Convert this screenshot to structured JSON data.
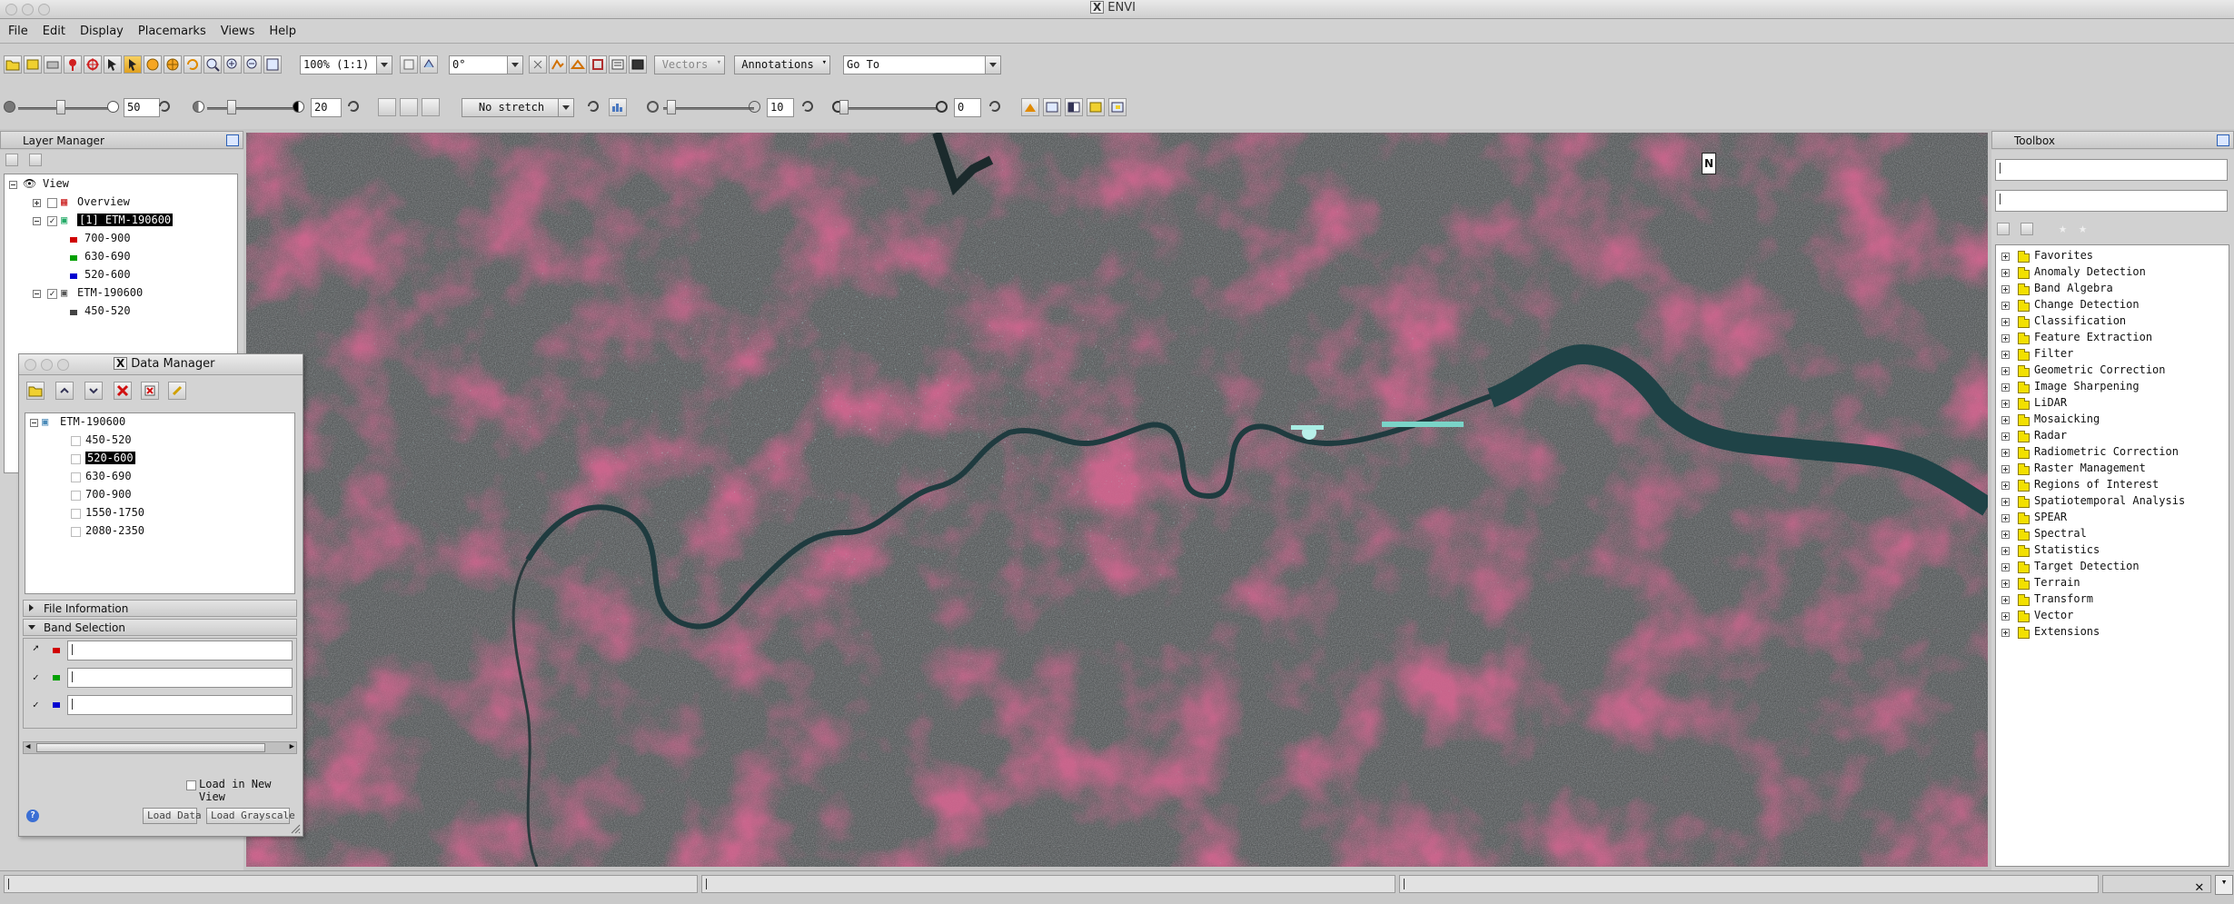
{
  "window": {
    "title": "ENVI"
  },
  "menu": [
    "File",
    "Edit",
    "Display",
    "Placemarks",
    "Views",
    "Help"
  ],
  "toolbar1": {
    "zoom_value": "100% (1:1)",
    "rotation_value": "0°",
    "vectors_label": "Vectors",
    "annotations_label": "Annotations",
    "goto_placeholder": "Go To"
  },
  "toolbar2": {
    "brightness": "50",
    "contrast": "20",
    "stretch": "No stretch",
    "sharpen": "10",
    "transparency": "0"
  },
  "layer_manager": {
    "title": "Layer Manager",
    "root": "View",
    "items": [
      {
        "label": "Overview"
      },
      {
        "label": "[1] ETM-190600"
      },
      {
        "label": "700-900",
        "color": "#d00000"
      },
      {
        "label": "630-690",
        "color": "#00a000"
      },
      {
        "label": "520-600",
        "color": "#0000d0"
      },
      {
        "label": "ETM-190600"
      },
      {
        "label": "450-520",
        "color": "#444444"
      }
    ]
  },
  "data_manager": {
    "title": "Data Manager",
    "file": "ETM-190600",
    "bands": [
      "450-520",
      "520-600",
      "630-690",
      "700-900",
      "1550-1750",
      "2080-2350"
    ],
    "selected_band": "520-600",
    "sections": {
      "file_info": "File Information",
      "band_selection": "Band Selection"
    },
    "band_slots": [
      {
        "color": "#d00000"
      },
      {
        "color": "#00a000"
      },
      {
        "color": "#0000d0"
      }
    ],
    "load_new_view": "Load in New View",
    "load_data": "Load Data",
    "load_grayscale": "Load Grayscale"
  },
  "toolbox": {
    "title": "Toolbox",
    "items": [
      "Favorites",
      "Anomaly Detection",
      "Band Algebra",
      "Change Detection",
      "Classification",
      "Feature Extraction",
      "Filter",
      "Geometric Correction",
      "Image Sharpening",
      "LiDAR",
      "Mosaicking",
      "Radar",
      "Radiometric Correction",
      "Raster Management",
      "Regions of Interest",
      "Spatiotemporal Analysis",
      "SPEAR",
      "Spectral",
      "Statistics",
      "Target Detection",
      "Terrain",
      "Transform",
      "Vector",
      "Extensions"
    ]
  },
  "view": {
    "north_label": "N"
  }
}
